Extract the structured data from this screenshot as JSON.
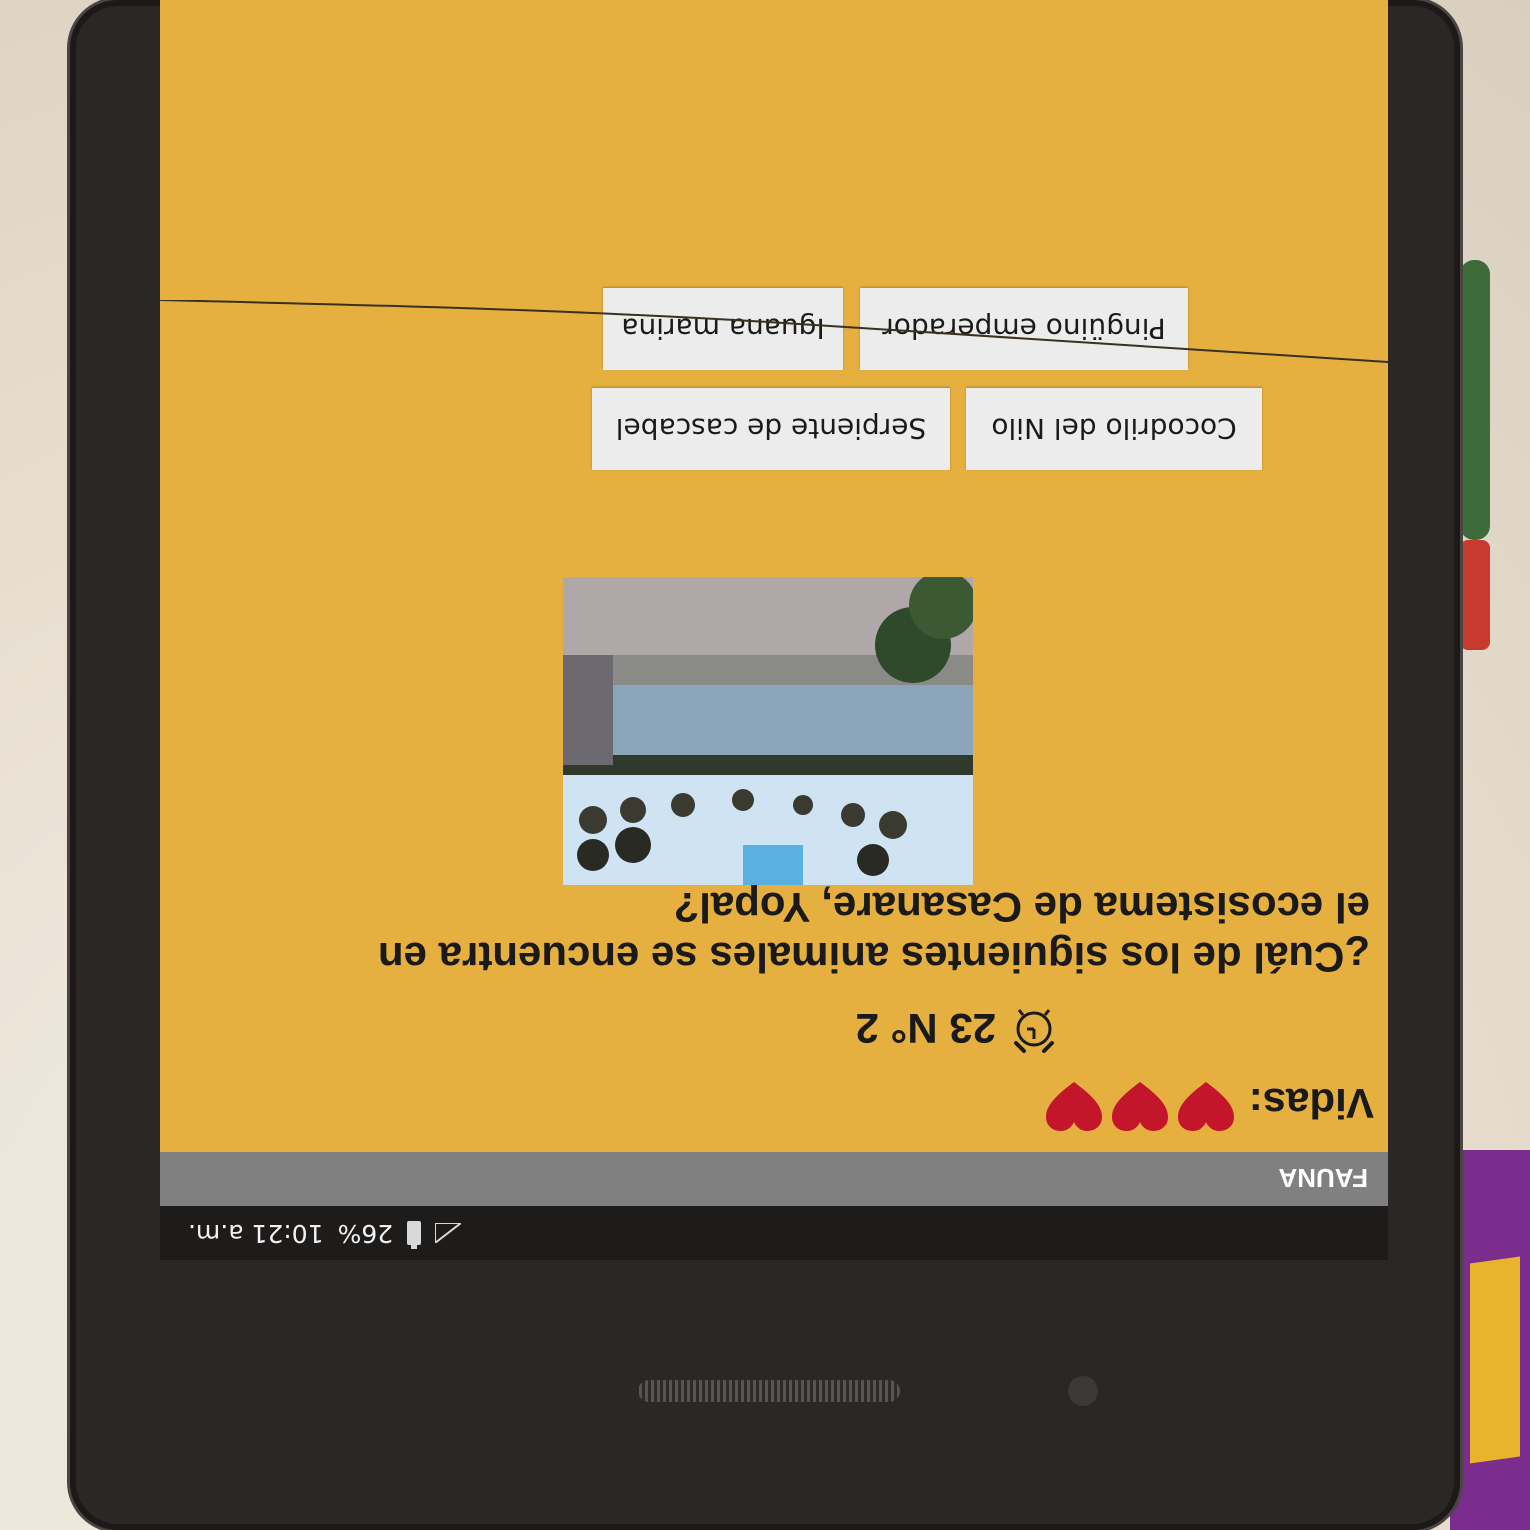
{
  "status_bar": {
    "battery": "26%",
    "time": "10:21 a.m."
  },
  "app_bar": {
    "title": "FAUNA"
  },
  "game": {
    "lives_label": "Vidas:",
    "lives_count": 3,
    "timer_text": "23 N° 2",
    "question": "¿Cuál de los siguientes animales se encuentra en el ecosistema de Casanare, Yopal?"
  },
  "options": [
    {
      "label": "Cocodrilo del Nilo"
    },
    {
      "label": "Serpiente de cascabel"
    },
    {
      "label": "Pingüino emperador"
    },
    {
      "label": "Iguana marina"
    }
  ],
  "colors": {
    "screen_background": "#e6b040",
    "heart": "#c4162a",
    "app_bar": "#808080",
    "button": "#ececec"
  },
  "icons": {
    "clock": "alarm-clock-icon",
    "heart": "heart-icon",
    "battery": "battery-icon",
    "signal": "signal-icon"
  }
}
